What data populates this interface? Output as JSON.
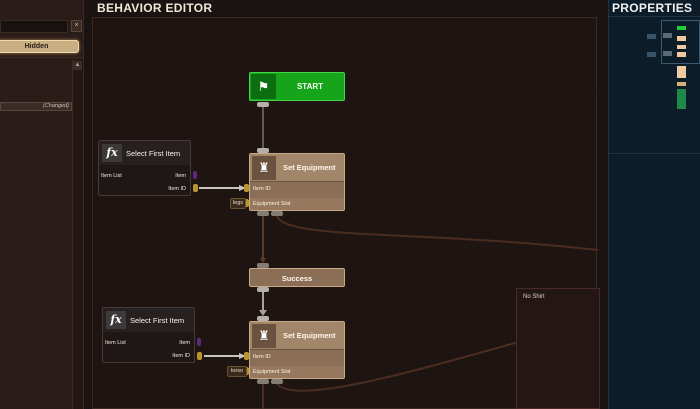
{
  "left_panel": {
    "close_label": "×",
    "hidden_button_label": "Hidden",
    "changed_label": "(Changed)",
    "scroll_up_label": "▲"
  },
  "editor": {
    "title": "BEHAVIOR EDITOR",
    "start_node": {
      "label": "START",
      "icon": "flag-icon"
    },
    "equip_nodes": [
      {
        "title": "Set Equipment",
        "row1": "Item ID",
        "row2": "Equipment Slot",
        "slot_value": "legs",
        "icon": "armor-icon"
      },
      {
        "title": "Set Equipment",
        "row1": "Item ID",
        "row2": "Equipment Slot",
        "slot_value": "torso",
        "icon": "armor-icon"
      }
    ],
    "fx_nodes": [
      {
        "icon_label": "fx",
        "title": "Select First Item",
        "in_label": "Item List",
        "out1": "Item",
        "out2": "Item ID"
      },
      {
        "icon_label": "fx",
        "title": "Select First Item",
        "in_label": "Item List",
        "out1": "Item",
        "out2": "Item ID"
      }
    ],
    "success_node": {
      "label": "Success"
    },
    "no_shirt_label": "No Shirt"
  },
  "properties": {
    "title": "PROPERTIES"
  },
  "colors": {
    "start_green": "#16a41b",
    "node_tan": "#8b6e56",
    "wire_brown": "#5a3a28",
    "properties_bg": "#0d1c29"
  }
}
